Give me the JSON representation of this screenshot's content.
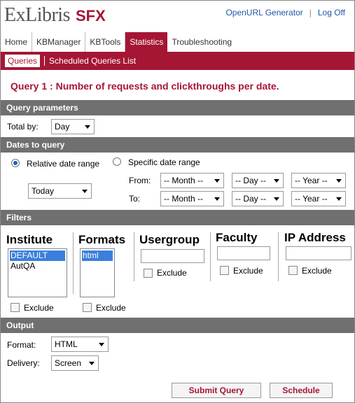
{
  "header": {
    "logo_main": "ExLibris",
    "logo_product": "SFX",
    "links": [
      "OpenURL Generator",
      "Log Off"
    ]
  },
  "tabs": [
    "Home",
    "KBManager",
    "KBTools",
    "Statistics",
    "Troubleshooting"
  ],
  "active_tab": "Statistics",
  "subnav": [
    "Queries",
    "Scheduled Queries List"
  ],
  "page_title": "Query 1 : Number of requests and clickthroughs per date.",
  "sections": {
    "params": "Query parameters",
    "dates": "Dates to query",
    "filters": "Filters",
    "output": "Output"
  },
  "params": {
    "total_by_label": "Total by:",
    "total_by_value": "Day"
  },
  "dates": {
    "relative_label": "Relative date range",
    "specific_label": "Specific date range",
    "relative_value": "Today",
    "from_label": "From:",
    "to_label": "To:",
    "month_placeholder": "-- Month --",
    "day_placeholder": "-- Day --",
    "year_placeholder": "-- Year --"
  },
  "filters": {
    "institute": {
      "title": "Institute",
      "options": [
        "DEFAULT",
        "AutQA"
      ]
    },
    "formats": {
      "title": "Formats",
      "options": [
        "html"
      ]
    },
    "usergroup": {
      "title": "Usergroup"
    },
    "faculty": {
      "title": "Faculty"
    },
    "ip_address": {
      "title": "IP Address"
    },
    "exclude_label": "Exclude"
  },
  "output": {
    "format_label": "Format:",
    "format_value": "HTML",
    "delivery_label": "Delivery:",
    "delivery_value": "Screen"
  },
  "buttons": {
    "submit": "Submit Query",
    "schedule": "Schedule"
  },
  "colors": {
    "brand": "#a51635",
    "section_bg": "#707070",
    "link": "#2255aa",
    "selection": "#3a7fdc"
  }
}
